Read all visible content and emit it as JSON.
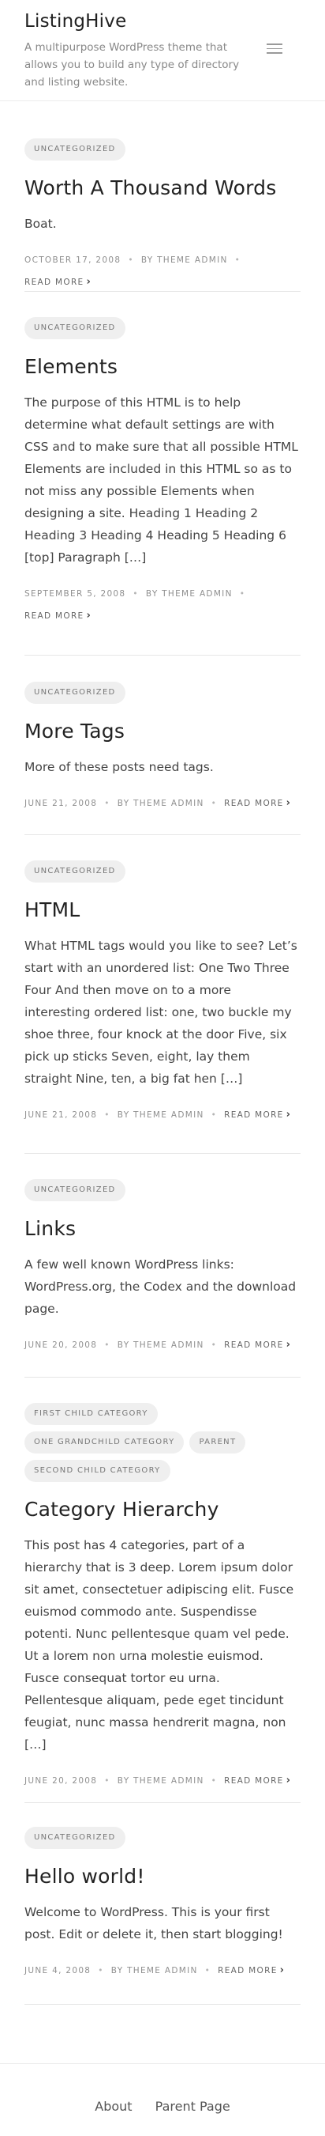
{
  "header": {
    "site_title": "ListingHive",
    "site_description": "A multipurpose WordPress theme that allows you to build any type of directory and listing website."
  },
  "posts": [
    {
      "categories": [
        "Uncategorized"
      ],
      "title": "Worth A Thousand Words",
      "excerpt": "Boat.",
      "date": "October 17, 2008",
      "author": "By Theme Admin",
      "read_more": "Read More"
    },
    {
      "categories": [
        "Uncategorized"
      ],
      "title": "Elements",
      "excerpt": "The purpose of this HTML is to help determine what default settings are with CSS and to make sure that all possible HTML Elements are included in this HTML so as to not miss any possible Elements when designing a site. Heading 1 Heading 2 Heading 3 Heading 4 Heading 5 Heading 6 [top] Paragraph […]",
      "date": "September 5, 2008",
      "author": "By Theme Admin",
      "read_more": "Read More"
    },
    {
      "categories": [
        "Uncategorized"
      ],
      "title": "More Tags",
      "excerpt": "More of these posts need tags.",
      "date": "June 21, 2008",
      "author": "By Theme Admin",
      "read_more": "Read More"
    },
    {
      "categories": [
        "Uncategorized"
      ],
      "title": "HTML",
      "excerpt": "What HTML tags would you like to see? Let’s start with an unordered list: One Two Three Four And then move on to a more interesting ordered list: one, two buckle my shoe three, four knock at the door Five, six pick up sticks Seven, eight, lay them straight Nine, ten, a big fat hen […]",
      "date": "June 21, 2008",
      "author": "By Theme Admin",
      "read_more": "Read More"
    },
    {
      "categories": [
        "Uncategorized"
      ],
      "title": "Links",
      "excerpt": "A few well known WordPress links: WordPress.org, the Codex and the download page.",
      "date": "June 20, 2008",
      "author": "By Theme Admin",
      "read_more": "Read More"
    },
    {
      "categories": [
        "First Child Category",
        "One Grandchild Category",
        "Parent",
        "Second Child Category"
      ],
      "title": "Category Hierarchy",
      "excerpt": "This post has 4 categories, part of a hierarchy that is 3 deep. Lorem ipsum dolor sit amet, consectetuer adipiscing elit. Fusce euismod commodo ante. Suspendisse potenti. Nunc pellentesque quam vel pede. Ut a lorem non urna molestie euismod. Fusce consequat tortor eu urna. Pellentesque aliquam, pede eget tincidunt feugiat, nunc massa hendrerit magna, non […]",
      "date": "June 20, 2008",
      "author": "By Theme Admin",
      "read_more": "Read More"
    },
    {
      "categories": [
        "Uncategorized"
      ],
      "title": "Hello world!",
      "excerpt": "Welcome to WordPress. This is your first post. Edit or delete it, then start blogging!",
      "date": "June 4, 2008",
      "author": "By Theme Admin",
      "read_more": "Read More"
    }
  ],
  "footer": {
    "links": [
      "About",
      "Parent Page"
    ]
  },
  "icons": {
    "menu": "hamburger-menu-icon",
    "read_more": "chevron-right-icon"
  }
}
